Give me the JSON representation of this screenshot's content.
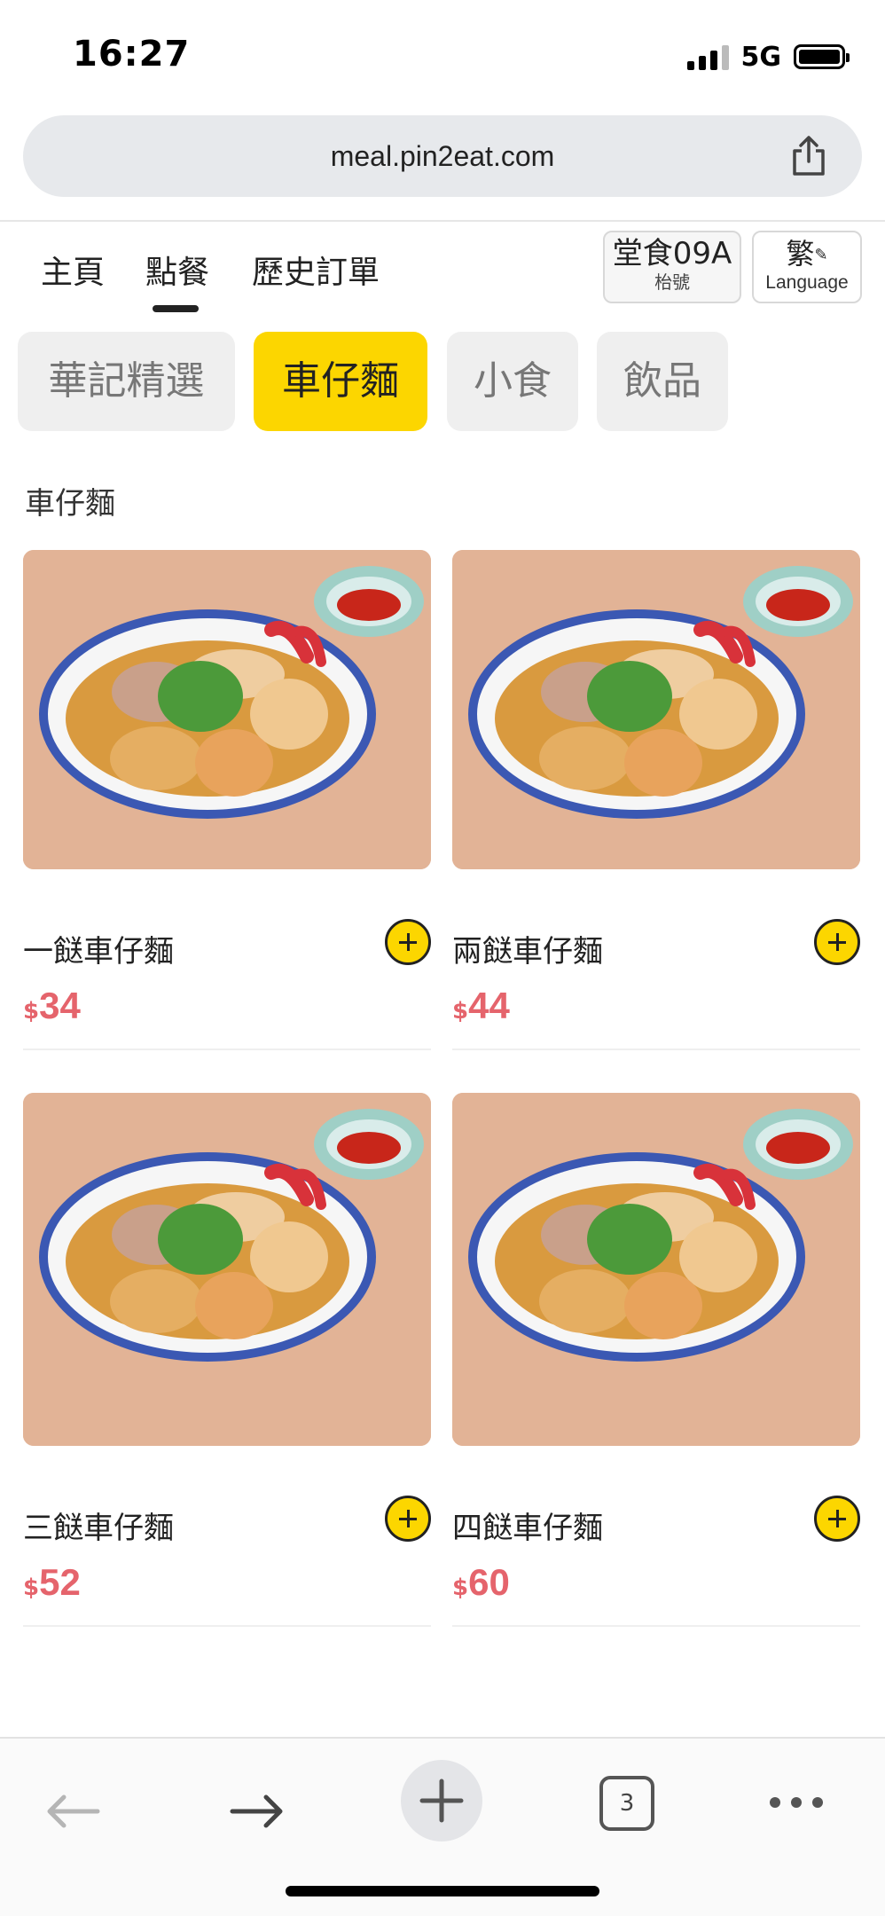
{
  "status_bar": {
    "time": "16:27",
    "network": "5G",
    "icons": [
      "signal-icon",
      "battery-icon"
    ]
  },
  "browser": {
    "url": "meal.pin2eat.com",
    "share_icon": "share-icon",
    "toolbar": {
      "back_icon": "arrow-left-icon",
      "forward_icon": "arrow-right-icon",
      "new_tab_icon": "plus-icon",
      "tab_count": "3",
      "more_icon": "more-dots-icon"
    }
  },
  "nav": {
    "tabs": [
      {
        "label": "主頁"
      },
      {
        "label": "點餐",
        "active": true
      },
      {
        "label": "歷史訂單"
      }
    ],
    "table": {
      "title": "堂食09A",
      "subtitle": "枱號"
    },
    "language": {
      "title": "繁",
      "subtitle": "Language",
      "icon": "pencil-icon"
    }
  },
  "categories": [
    {
      "label": "華記精選"
    },
    {
      "label": "車仔麵",
      "active": true
    },
    {
      "label": "小食"
    },
    {
      "label": "飲品"
    }
  ],
  "section_title": "車仔麵",
  "products": [
    {
      "name": "一餸車仔麵",
      "currency": "$",
      "price": "34"
    },
    {
      "name": "兩餸車仔麵",
      "currency": "$",
      "price": "44"
    },
    {
      "name": "三餸車仔麵",
      "currency": "$",
      "price": "52"
    },
    {
      "name": "四餸車仔麵",
      "currency": "$",
      "price": "60"
    }
  ],
  "colors": {
    "accent": "#fcd600",
    "price": "#e5646c",
    "chip_inactive": "#efefef"
  }
}
